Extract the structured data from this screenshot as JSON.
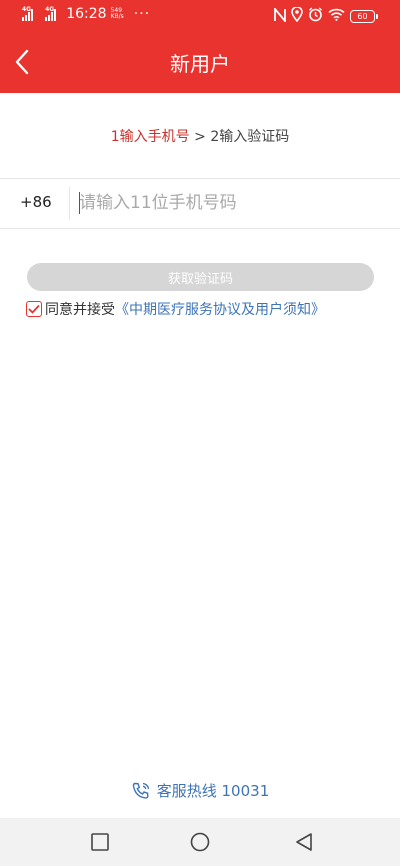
{
  "status_bar": {
    "network_1": "4G",
    "network_2": "4G",
    "time": "16:28",
    "speed_value": "549",
    "speed_unit": "KB/s",
    "more": "···",
    "battery": "60"
  },
  "header": {
    "title": "新用户",
    "back_icon": "chevron-left-icon"
  },
  "steps": {
    "step1": "1输入手机号",
    "separator": " > ",
    "step2": "2输入验证码"
  },
  "phone": {
    "country_code": "+86",
    "placeholder": "请输入11位手机号码",
    "value": ""
  },
  "get_code_button": "获取验证码",
  "agreement": {
    "checked": true,
    "prefix": "同意并接受",
    "link": "《中期医疗服务协议及用户须知》"
  },
  "hotline": {
    "label": "客服热线 10031",
    "icon": "phone-icon"
  },
  "system_nav": {
    "recent_icon": "square-icon",
    "home_icon": "circle-icon",
    "back_icon": "triangle-back-icon"
  },
  "colors": {
    "brand_red": "#e8332f",
    "link_blue": "#3d74b8",
    "disabled_gray": "#d6d6d6"
  }
}
